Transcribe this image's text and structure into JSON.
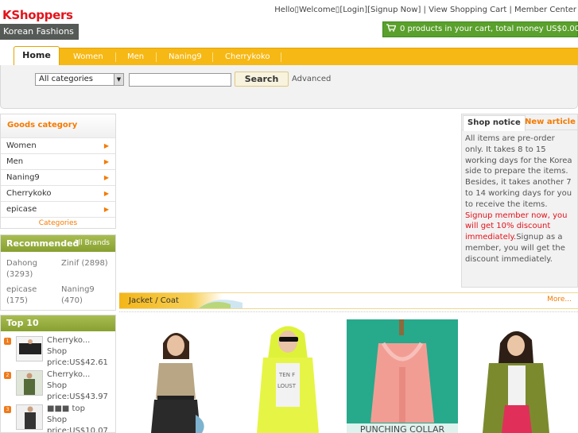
{
  "logo": {
    "name": "KShoppers",
    "tagline": "Korean Fashions"
  },
  "toplinks": {
    "hello": "Hello▯Welcome▯",
    "login": "[Login]",
    "signup": "[Signup Now]",
    "sep1": " | ",
    "view_cart": "View Shopping Cart",
    "sep2": " | ",
    "member_center": "Member Center"
  },
  "cart": {
    "summary": "0 products in your cart, total money US$0.00."
  },
  "nav": {
    "items": [
      {
        "label": "Home",
        "active": true
      },
      {
        "label": "Women"
      },
      {
        "label": "Men"
      },
      {
        "label": "Naning9"
      },
      {
        "label": "Cherrykoko"
      }
    ]
  },
  "search": {
    "category_selected": "All categories",
    "input_value": "",
    "button": "Search",
    "advanced": "Advanced"
  },
  "goods_category": {
    "title": "Goods category",
    "items": [
      "Women",
      "Men",
      "Naning9",
      "Cherrykoko",
      "epicase"
    ],
    "footer": "Categories"
  },
  "recommended": {
    "title": "Recommended",
    "all_brands": "All Brands",
    "brands": [
      {
        "name": "Dahong",
        "count": "(3293)"
      },
      {
        "name": "Zinif",
        "count": "(2898)"
      },
      {
        "name": "epicase",
        "count": "(175)"
      },
      {
        "name": "Naning9",
        "count": "(470)"
      }
    ]
  },
  "top10": {
    "title": "Top 10",
    "items": [
      {
        "name": "Cherryko...",
        "line2": "Shop",
        "price": "price:US$42.61"
      },
      {
        "name": "Cherryko...",
        "line2": "Shop",
        "price": "price:US$43.97"
      },
      {
        "name": "■■■ top",
        "line2": "Shop",
        "price": "price:US$10.07"
      }
    ]
  },
  "notice": {
    "tab_notice": "Shop notice",
    "tab_new": "New article",
    "text1": "All items are pre-order only. It takes 8 to 15 working days for the Korea side to prepare the items. Besides, it takes another 7 to 14 working days for you to receive the items. ",
    "text_red": "Signup member now, you will get 10% discount immediately.",
    "text2": "Signup as a member, you will get the discount immediately."
  },
  "section": {
    "title": "Jacket / Coat",
    "more": "More...",
    "product_caption": "PUNCHING COLLAR"
  },
  "colors": {
    "brand_red": "#e3131b",
    "nav_orange": "#f6b814",
    "accent_orange": "#f57a00",
    "cart_green": "#5aa02c",
    "panel_green": "#98ae40"
  },
  "icons": {
    "cart": "cart-icon",
    "arrow": "right-arrow-icon",
    "dropdown": "chevron-down-icon"
  }
}
